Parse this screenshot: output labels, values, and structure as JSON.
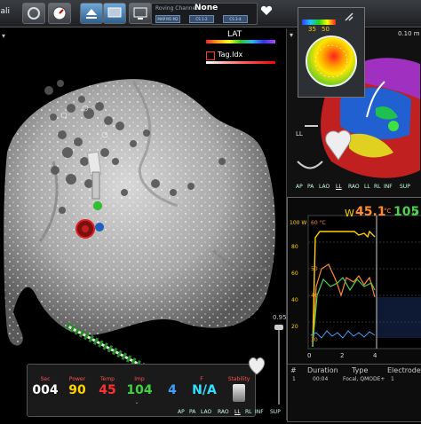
{
  "toolbar": {
    "left_label": "iali",
    "roving_channel_label": "Roving Channel:",
    "roving_channel_value": "None",
    "chips": [
      "MAP M1 M2",
      "CS 1-2",
      "CS 3-4"
    ]
  },
  "map": {
    "lat_label": "LAT",
    "tag_label": "Tag.Idx",
    "zoom_value": "0.95"
  },
  "bullseye": {
    "range_low": "35",
    "range_high": "50"
  },
  "right_panel": {
    "time_label": "0.10 m",
    "view_buttons": [
      "AP",
      "PA",
      "LAO",
      "LL",
      "RAO",
      "LL",
      "RL",
      "INF",
      "SUP"
    ],
    "active_view": "LL",
    "heart_label": "LL"
  },
  "graph": {
    "power_unit": "W",
    "temp": "45.1",
    "temp_unit": "°C",
    "imp": "105",
    "imp_unit": "Ω",
    "y_ticks_power": [
      "100 W",
      "80",
      "60",
      "40",
      "20"
    ],
    "y_ticks_temp": [
      "60 °C",
      "50",
      "40",
      "30"
    ],
    "x_ticks": [
      "0",
      "2",
      "4"
    ]
  },
  "table": {
    "headers": [
      "#",
      "Duration",
      "Type",
      "Electrode"
    ],
    "row": [
      "1",
      "00:04",
      "Focal, QMODE+",
      "1"
    ]
  },
  "ablation": {
    "labels": [
      "Sec",
      "Power",
      "Temp",
      "Imp",
      "",
      "F",
      "Stability"
    ],
    "values": [
      "004",
      "90",
      "45",
      "104",
      "4",
      "N/A",
      ""
    ],
    "colors": [
      "#ffffff",
      "#ffd200",
      "#ff3030",
      "#40d040",
      "#40a0ff",
      "#30e0ff",
      "#dddddd"
    ]
  },
  "bottom_views": [
    "AP",
    "PA",
    "LAO",
    "RAO",
    "LL",
    "RL",
    "INF",
    "SUP"
  ],
  "bottom_active": "LL"
}
